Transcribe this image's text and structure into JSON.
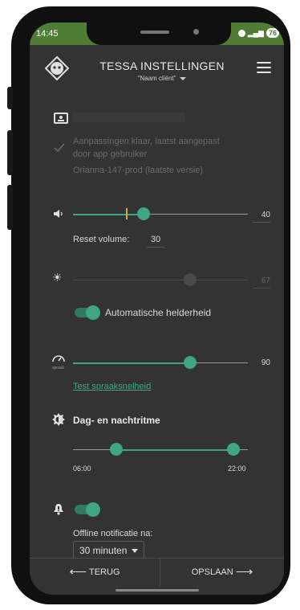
{
  "statusbar": {
    "time": "14:45",
    "battery": "76"
  },
  "header": {
    "title": "TESSA INSTELLINGEN",
    "client": "\"Naam cliënt\""
  },
  "app_info": {
    "line1": "Aanpassingen klaar, laatst aangepast",
    "line2": "door app gebruiker",
    "line3": "Orianna-147-prod (laatste versie)"
  },
  "volume": {
    "value": "40",
    "level": 40,
    "reset_label": "Reset volume:",
    "reset_value": "30"
  },
  "brightness": {
    "value": "67",
    "level": 67,
    "auto_label": "Automatische helderheid"
  },
  "speech": {
    "value": "90",
    "icon_caption": "spraak",
    "test_link": "Test spraaksnelheid"
  },
  "daynight": {
    "title": "Dag- en nachtritme",
    "start": "06:00",
    "end": "22:00"
  },
  "notification": {
    "offline_label": "Offline notificatie na:",
    "offline_value": "30 minuten"
  },
  "footer": {
    "back_label": "TERUG",
    "save_label": "OPSLAAN"
  },
  "colors": {
    "accent": "#3fa582",
    "status_bar": "#4f7d35",
    "background": "#333333"
  }
}
